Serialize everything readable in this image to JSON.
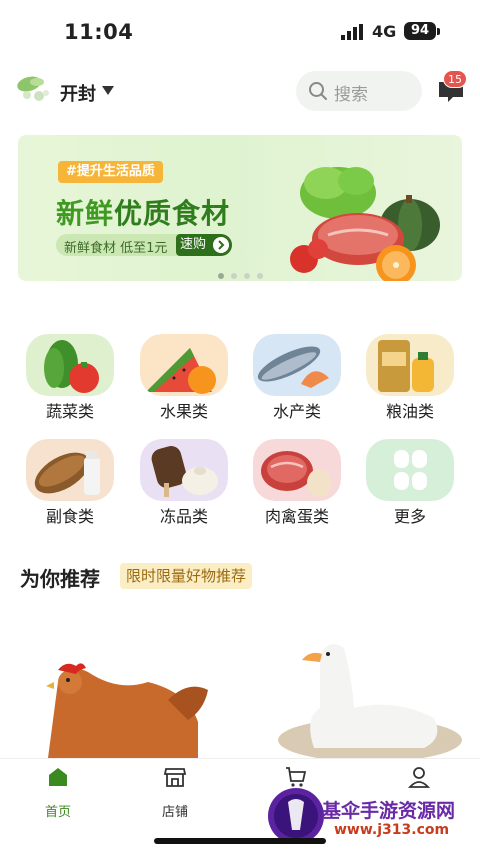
{
  "status_bar": {
    "time": "11:04",
    "network": "4G",
    "battery": "94"
  },
  "header": {
    "city": "开封",
    "search_placeholder": "搜索",
    "message_badge": "15"
  },
  "banner": {
    "tag": "#提升生活品质",
    "title_highlight": "新鲜",
    "title_rest": "优质食材",
    "subtitle": "新鲜食材 低至1元",
    "cta": "速购"
  },
  "categories": [
    {
      "label": "蔬菜类",
      "icon": "vegetables-icon"
    },
    {
      "label": "水果类",
      "icon": "fruits-icon"
    },
    {
      "label": "水产类",
      "icon": "seafood-icon"
    },
    {
      "label": "粮油类",
      "icon": "grain-oil-icon"
    },
    {
      "label": "副食类",
      "icon": "bread-milk-icon"
    },
    {
      "label": "冻品类",
      "icon": "frozen-icon"
    },
    {
      "label": "肉禽蛋类",
      "icon": "meat-egg-icon"
    },
    {
      "label": "更多",
      "icon": "more-grid-icon"
    }
  ],
  "recommend": {
    "title": "为你推荐",
    "tag": "限时限量好物推荐"
  },
  "products": [
    {
      "name": "hen",
      "image": "hen-image"
    },
    {
      "name": "duck",
      "image": "duck-image"
    }
  ],
  "tabbar": {
    "items": [
      {
        "label": "首页",
        "icon": "home-icon",
        "active": true
      },
      {
        "label": "店铺",
        "icon": "store-icon",
        "active": false
      },
      {
        "label": "",
        "icon": "cart-icon",
        "active": false
      },
      {
        "label": "",
        "icon": "user-icon",
        "active": false
      }
    ]
  },
  "watermark": {
    "text": "基伞手游资源网",
    "url": "www.j313.com"
  },
  "colors": {
    "brand_green": "#3b8a1f",
    "badge_red": "#e4554f",
    "tag_orange": "#f6b538"
  }
}
